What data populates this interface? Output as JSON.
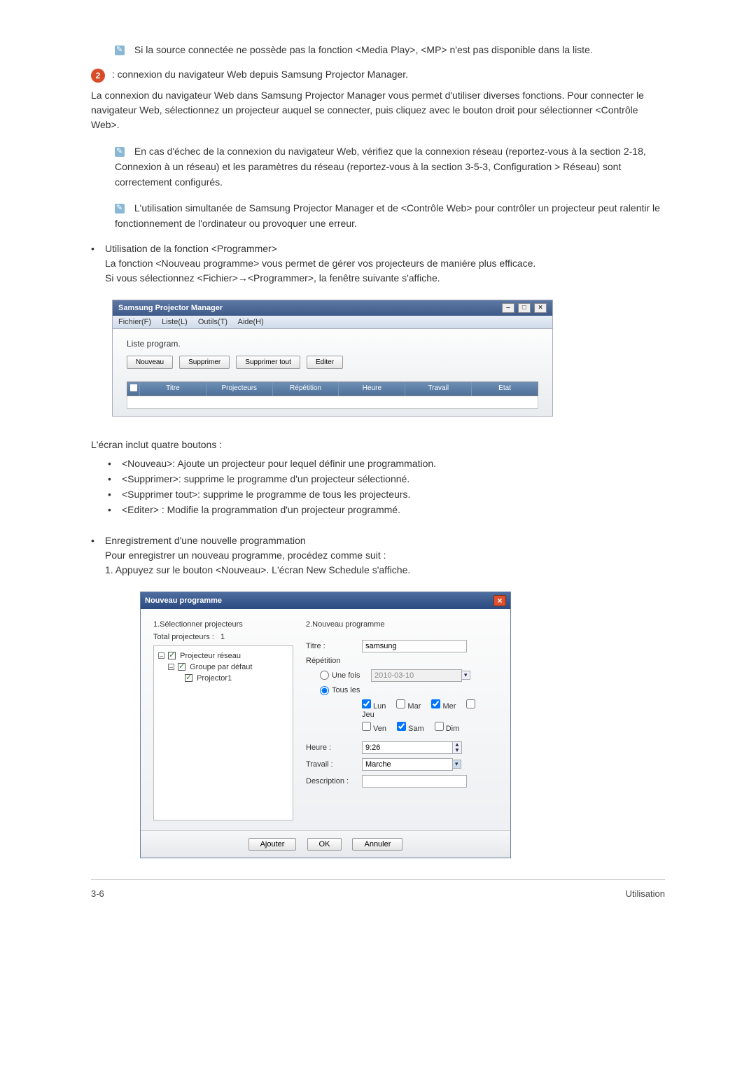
{
  "notes": {
    "mp_unavailable": "Si la source connectée ne possède pas la fonction <Media Play>, <MP> n'est pas disponible dans la liste.",
    "web_fail": "En cas d'échec de la connexion du navigateur Web, vérifiez que la connexion réseau (reportez-vous à la section 2-18, Connexion à un réseau) et les paramètres du réseau (reportez-vous à la section 3-5-3, Configuration > Réseau) sont correctement configurés.",
    "simultaneous": "L'utilisation simultanée de Samsung Projector Manager et de <Contrôle Web> pour contrôler un projecteur peut ralentir le fonctionnement de l'ordinateur ou provoquer une erreur."
  },
  "step2": {
    "num": "2",
    "title": ": connexion du navigateur Web depuis Samsung Projector Manager.",
    "desc": "La connexion du navigateur Web dans Samsung Projector Manager vous permet d'utiliser diverses fonctions. Pour connecter le navigateur Web, sélectionnez un projecteur auquel se connecter, puis cliquez avec le bouton droit pour sélectionner <Contrôle Web>."
  },
  "programmer": {
    "heading": "Utilisation de la fonction <Programmer>",
    "line1": "La fonction <Nouveau programme> vous permet de gérer vos projecteurs de manière plus efficace.",
    "line2": "Si vous sélectionnez <Fichier>→<Programmer>, la fenêtre suivante s'affiche."
  },
  "spm": {
    "title": "Samsung Projector Manager",
    "menu": [
      "Fichier(F)",
      "Liste(L)",
      "Outils(T)",
      "Aide(H)"
    ],
    "list_label": "Liste program.",
    "buttons": [
      "Nouveau",
      "Supprimer",
      "Supprimer tout",
      "Editer"
    ],
    "cols": [
      "Titre",
      "Projecteurs",
      "Répétition",
      "Heure",
      "Travail",
      "Etat"
    ]
  },
  "four_buttons": {
    "intro": "L'écran inclut quatre boutons :",
    "items": [
      "<Nouveau>: Ajoute un projecteur pour lequel définir une programmation.",
      "<Supprimer>: supprime le programme d'un projecteur sélectionné.",
      "<Supprimer tout>: supprime le programme de tous les projecteurs.",
      "<Editer> : Modifie la programmation d'un projecteur programmé."
    ]
  },
  "register": {
    "heading": "Enregistrement d'une nouvelle programmation",
    "line1": "Pour enregistrer un nouveau programme, procédez comme suit :",
    "line2": "1. Appuyez sur le bouton <Nouveau>. L'écran New Schedule s'affiche."
  },
  "np": {
    "title": "Nouveau programme",
    "left_title": "1.Sélectionner projecteurs",
    "total_label": "Total projecteurs :",
    "total_value": "1",
    "tree": {
      "root": "Projecteur réseau",
      "group": "Groupe par défaut",
      "leaf": "Projector1"
    },
    "right_title": "2.Nouveau programme",
    "labels": {
      "titre": "Titre :",
      "repetition": "Répétition",
      "une_fois": "Une fois",
      "tous_les": "Tous les",
      "heure": "Heure :",
      "travail": "Travail :",
      "description": "Description :"
    },
    "values": {
      "titre": "samsung",
      "date": "2010-03-10",
      "heure": "9:26",
      "travail": "Marche"
    },
    "days": {
      "lun": "Lun",
      "mar": "Mar",
      "mer": "Mer",
      "jeu": "Jeu",
      "ven": "Ven",
      "sam": "Sam",
      "dim": "Dim"
    },
    "days_checked": [
      "lun",
      "mer",
      "sam"
    ],
    "footer": [
      "Ajouter",
      "OK",
      "Annuler"
    ]
  },
  "footer": {
    "left": "3-6",
    "right": "Utilisation"
  }
}
